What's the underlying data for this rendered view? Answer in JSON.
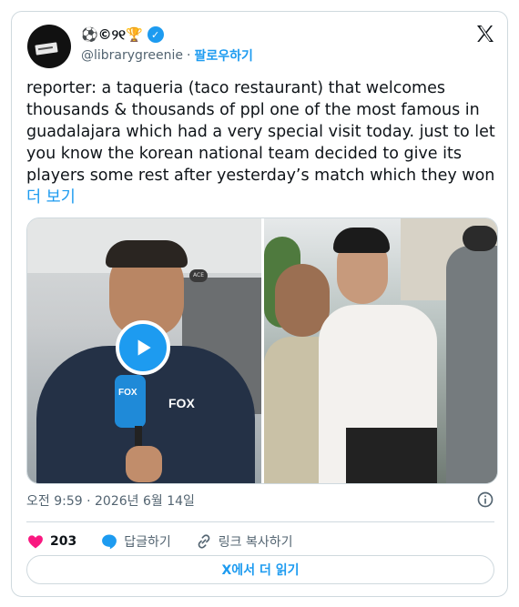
{
  "author": {
    "display_name": "⚽©୨୧🏆",
    "handle": "@librarygreenie",
    "follow_label": "팔로우하기",
    "verified": true
  },
  "tweet": {
    "text": "reporter: a taqueria (taco restaurant) that welcomes thousands & thousands of ppl one of the most famous in guadalajara which had a very special visit today. just to let you know the korean national team decided to give its players some rest after yesterday’s match which they won ",
    "more_label": "더 보기"
  },
  "media": {
    "left_mic_label": "FOX",
    "left_shirt_label": "FOX",
    "left_sign_label": "ACE"
  },
  "meta": {
    "timestamp": "오전 9:59 · 2026년 6월 14일"
  },
  "actions": {
    "like_count": "203",
    "reply_label": "답글하기",
    "copy_link_label": "링크 복사하기"
  },
  "read_more_button": "X에서 더 읽기",
  "colors": {
    "accent": "#1d9bf0",
    "like": "#f91880",
    "text": "#0f1419",
    "muted": "#536471",
    "border": "#cfd9de"
  },
  "icons": [
    "x-logo-icon",
    "verified-icon",
    "play-icon",
    "info-icon",
    "heart-icon",
    "reply-icon",
    "link-icon"
  ]
}
